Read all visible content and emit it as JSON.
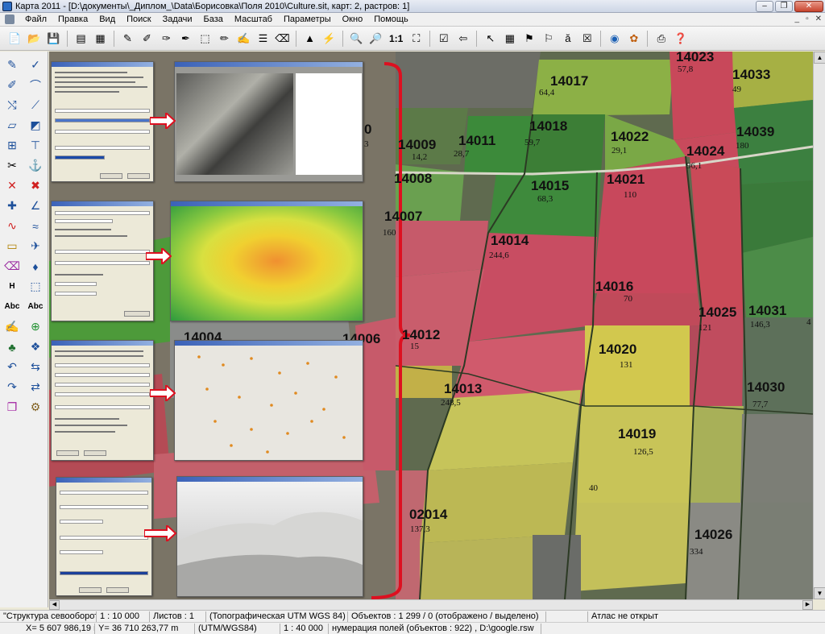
{
  "window": {
    "title": "Карта 2011 - [D:\\документы\\_Диплом_\\Data\\Борисовка\\Поля 2010\\Culture.sit, карт: 2, растров: 1]",
    "controls": [
      "–",
      "❐",
      "✕"
    ]
  },
  "menu": [
    "Файл",
    "Правка",
    "Вид",
    "Поиск",
    "Задачи",
    "База",
    "Масштаб",
    "Параметры",
    "Окно",
    "Помощь"
  ],
  "mdi_controls": [
    "_",
    "▫",
    "✕"
  ],
  "toolbar": {
    "icons": [
      "new-file-icon",
      "open-folder-icon",
      "save-icon",
      "layers-icon",
      "atlas-icon",
      "select-icon",
      "select-add-icon",
      "select-filter-icon",
      "select-remove-icon",
      "frame-select-icon",
      "select-object-icon",
      "select-region-icon",
      "list-icon",
      "clear-select-icon",
      "triangle-tool-icon",
      "lightning-icon",
      "zoom-out-icon",
      "zoom-in-icon",
      "zoom-full-icon",
      "check-icon",
      "back-icon",
      "cursor-icon",
      "table-icon",
      "flag-icon",
      "flag-remove-icon",
      "text-icon",
      "abc-icon",
      "globe-icon",
      "paint-icon",
      "print-icon",
      "help-icon"
    ],
    "zoom_label": "1:1"
  },
  "fields": [
    {
      "id": "14023",
      "val": "57,8"
    },
    {
      "id": "14033",
      "val": "49"
    },
    {
      "id": "14017",
      "val": "64,4"
    },
    {
      "id": "14018",
      "val": "59,7"
    },
    {
      "id": "14022",
      "val": "29,1"
    },
    {
      "id": "14039",
      "val": "180"
    },
    {
      "id": "14009",
      "val": "14,2"
    },
    {
      "id": "14011",
      "val": "28,7"
    },
    {
      "id": "14024",
      "val": "96,1"
    },
    {
      "id": "14008",
      "val": ""
    },
    {
      "id": "14015",
      "val": "68,3"
    },
    {
      "id": "14021",
      "val": "110"
    },
    {
      "id": "14007",
      "val": "160"
    },
    {
      "id": "14014",
      "val": "244,6"
    },
    {
      "id": "14016",
      "val": "70"
    },
    {
      "id": "14025",
      "val": "121"
    },
    {
      "id": "14031",
      "val": "146,3"
    },
    {
      "id": "14004",
      "val": ""
    },
    {
      "id": "14006",
      "val": ""
    },
    {
      "id": "14012",
      "val": "15"
    },
    {
      "id": "14020",
      "val": "131"
    },
    {
      "id": "14013",
      "val": "248,5"
    },
    {
      "id": "14030",
      "val": "77,7"
    },
    {
      "id": "14019",
      "val": "126,5"
    },
    {
      "id": "02014",
      "val": "137,3"
    },
    {
      "id": "14026",
      "val": "334"
    }
  ],
  "fragments": {
    "f0": "0",
    "f3": "3",
    "f40": "40",
    "f_dot": "4"
  },
  "status": {
    "layer": "\"Структура севооборота\"",
    "scale": "1 : 10 000",
    "sheets": "Листов : 1",
    "projection": "(Топографическая UTM WGS 84)",
    "objects": "Объектов : 1 299 / 0 (отображено / выделено)",
    "atlas": "Атлас не открыт",
    "coord_x": "X= 5 607 986,19 m",
    "coord_y": "Y= 36 710 263,77 m",
    "crs": "(UTM/WGS84)",
    "scale2": "1 : 40 000",
    "layer_info": "нумерация полей  (объектов : 922) , D:\\google.rsw"
  }
}
